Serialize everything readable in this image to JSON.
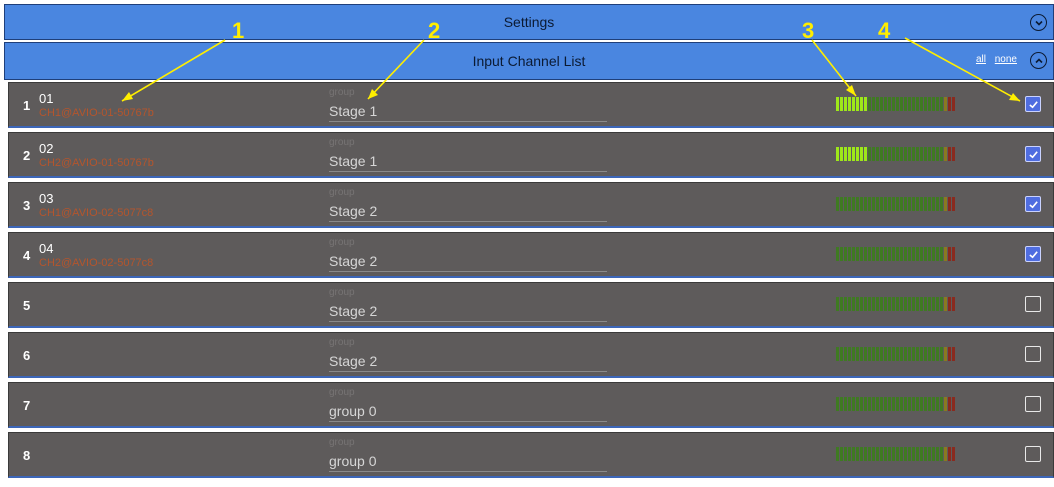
{
  "header": {
    "title": "Settings"
  },
  "subheader": {
    "title": "Input Channel List",
    "all_label": "all",
    "none_label": "none"
  },
  "channels": [
    {
      "number": "1",
      "name": "01",
      "source": "CH1@AVIO-01-50767b",
      "group_label": "group",
      "group": "Stage 1",
      "meter_level": 0.25,
      "checked": true
    },
    {
      "number": "2",
      "name": "02",
      "source": "CH2@AVIO-01-50767b",
      "group_label": "group",
      "group": "Stage 1",
      "meter_level": 0.25,
      "checked": true
    },
    {
      "number": "3",
      "name": "03",
      "source": "CH1@AVIO-02-5077c8",
      "group_label": "group",
      "group": "Stage 2",
      "meter_level": 0,
      "checked": true
    },
    {
      "number": "4",
      "name": "04",
      "source": "CH2@AVIO-02-5077c8",
      "group_label": "group",
      "group": "Stage 2",
      "meter_level": 0,
      "checked": true
    },
    {
      "number": "5",
      "name": "",
      "source": "",
      "group_label": "group",
      "group": "Stage 2",
      "meter_level": 0,
      "checked": false
    },
    {
      "number": "6",
      "name": "",
      "source": "",
      "group_label": "group",
      "group": "Stage 2",
      "meter_level": 0,
      "checked": false
    },
    {
      "number": "7",
      "name": "",
      "source": "",
      "group_label": "group",
      "group": "group 0",
      "meter_level": 0,
      "checked": false
    },
    {
      "number": "8",
      "name": "",
      "source": "",
      "group_label": "group",
      "group": "group 0",
      "meter_level": 0,
      "checked": false
    }
  ],
  "annotations": [
    "1",
    "2",
    "3",
    "4"
  ],
  "colors": {
    "bar_blue": "#4a86e0",
    "row_bg": "#5e5b5b",
    "source_text": "#b5552c",
    "meter_active": "#9ee81a",
    "meter_idle": "#3f7a22",
    "meter_warn": "#8a7a20",
    "meter_clip": "#8a2a1e",
    "checkbox_on": "#4f6de0",
    "annotation": "#ffee00"
  }
}
